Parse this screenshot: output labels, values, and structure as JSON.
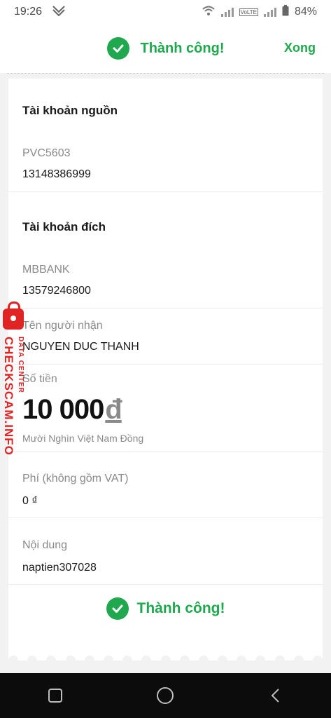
{
  "status_bar": {
    "time": "19:26",
    "battery": "84%",
    "volte": "VoLTE"
  },
  "header": {
    "title": "Thành công!",
    "done_label": "Xong"
  },
  "source_account": {
    "title": "Tài khoản nguồn",
    "name": "PVC5603",
    "number": "13148386999"
  },
  "dest_account": {
    "title": "Tài khoản đích",
    "bank": "MBBANK",
    "number": "13579246800"
  },
  "recipient": {
    "label": "Tên người nhận",
    "value": "NGUYEN DUC THANH"
  },
  "amount": {
    "label": "Số tiền",
    "value": "10 000",
    "currency": "đ",
    "words": "Mười Nghìn Việt Nam Đồng"
  },
  "fee": {
    "label": "Phí (không gồm VAT)",
    "value": "0 ₫"
  },
  "content": {
    "label": "Nội dung",
    "value": "naptien307028"
  },
  "footer": {
    "success": "Thành công!"
  },
  "watermark": {
    "main": "CHECKSCAM.INFO",
    "sub": "DATA CENTER"
  },
  "colors": {
    "success_green": "#1fa84e",
    "watermark_red": "#e02424"
  }
}
